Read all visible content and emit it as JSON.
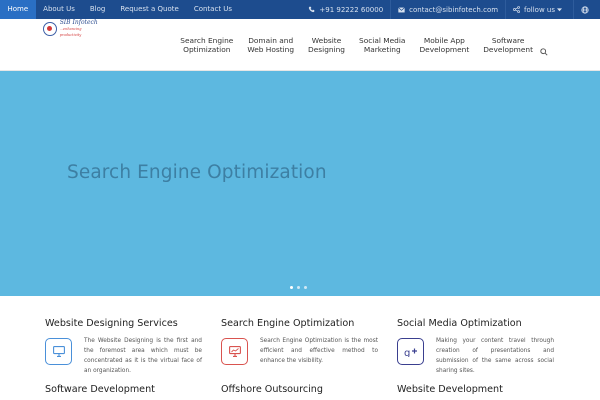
{
  "topbar": {
    "nav": [
      "Home",
      "About Us",
      "Blog",
      "Request a Quote",
      "Contact Us"
    ],
    "phone": "+91 92222 60000",
    "email": "contact@sibinfotech.com",
    "follow": "follow us",
    "phone_icon": "phone-icon",
    "email_icon": "envelope-icon",
    "share_icon": "share-icon",
    "globe_icon": "globe-icon"
  },
  "logo": {
    "name": "SIB Infotech",
    "tagline": "...enhancing productivity"
  },
  "mainnav": [
    {
      "l1": "Search Engine",
      "l2": "Optimization"
    },
    {
      "l1": "Domain and",
      "l2": "Web Hosting"
    },
    {
      "l1": "Website",
      "l2": "Designing"
    },
    {
      "l1": "Social Media",
      "l2": "Marketing"
    },
    {
      "l1": "Mobile App",
      "l2": "Development"
    },
    {
      "l1": "Software",
      "l2": "Development"
    }
  ],
  "hero": {
    "title": "Search Engine Optimization",
    "slides": 3,
    "active_slide": 1
  },
  "services": [
    {
      "title": "Website Designing Services",
      "text": "The Website Designing is the first and the foremost area which must be concentrated as it is the virtual face of an organization.",
      "icon": "monitor-icon",
      "color": "#4a90d9"
    },
    {
      "title": "Search Engine Optimization",
      "text": "Search Engine Optimization is the most efficient and effective method to enhance the visibility.",
      "icon": "chart-icon",
      "color": "#d9534f"
    },
    {
      "title": "Social Media Optimization",
      "text": "Making your content travel through creation of presentations and submission of the same across social sharing sites.",
      "icon": "google-plus-icon",
      "color": "#3a3f8f"
    },
    {
      "title": "Software Development"
    },
    {
      "title": "Offshore Outsourcing"
    },
    {
      "title": "Website Development"
    }
  ],
  "colors": {
    "topbar": "#1d4c8e",
    "active": "#2a6fc4",
    "hero": "#5db8e0",
    "hero_text": "#3d7fa3"
  }
}
